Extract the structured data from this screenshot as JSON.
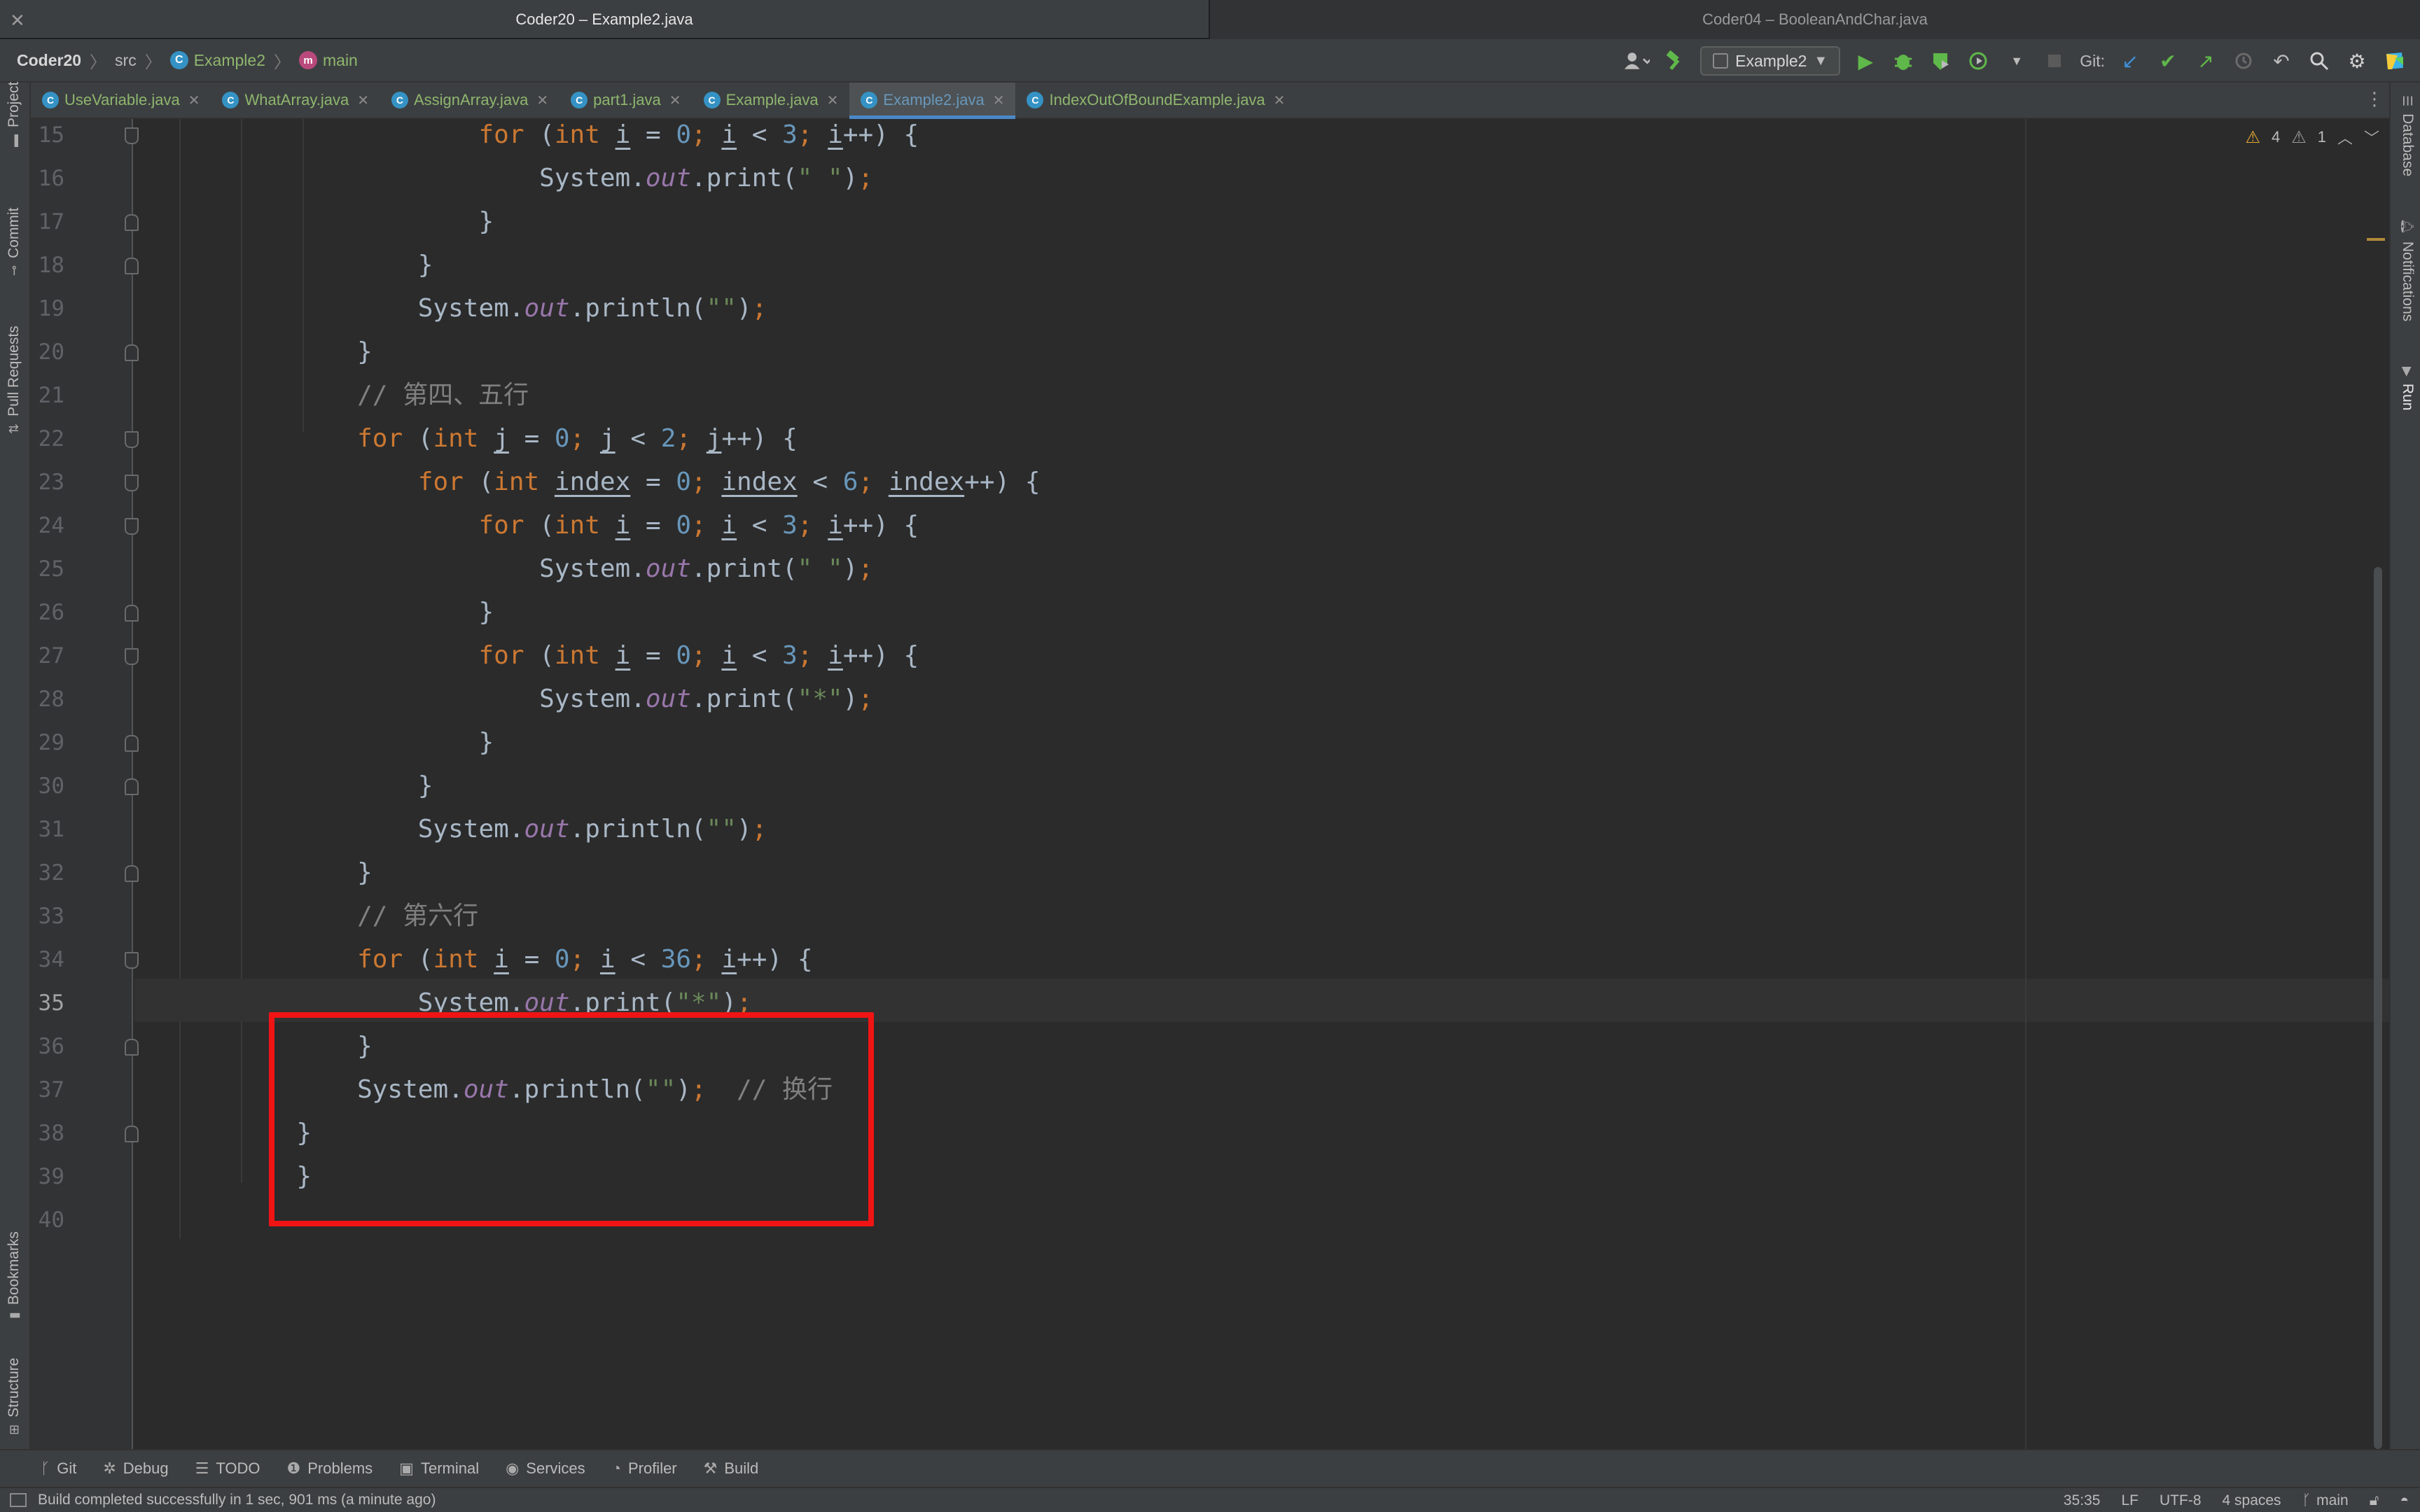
{
  "window_tabs": [
    "Coder20 – Example2.java",
    "Coder04 – BooleanAndChar.java"
  ],
  "breadcrumb": {
    "project": "Coder20",
    "folder": "src",
    "class": "Example2",
    "method": "main",
    "class_glyph": "C",
    "method_glyph": "m"
  },
  "toolbar": {
    "run_config": "Example2",
    "git_label": "Git:",
    "icons": [
      "account-icon",
      "build-hammer-icon",
      "run-icon",
      "debug-icon",
      "coverage-icon",
      "profile-icon",
      "stop-icon",
      "git-update-icon",
      "git-commit-icon",
      "git-push-icon",
      "history-icon",
      "rollback-icon",
      "search-icon",
      "settings-icon",
      "product-logo-icon"
    ]
  },
  "editor_tabs": [
    {
      "label": "UseVariable.java",
      "active": false
    },
    {
      "label": "WhatArray.java",
      "active": false
    },
    {
      "label": "AssignArray.java",
      "active": false
    },
    {
      "label": "part1.java",
      "active": false
    },
    {
      "label": "Example.java",
      "active": false
    },
    {
      "label": "Example2.java",
      "active": true
    },
    {
      "label": "IndexOutOfBoundExample.java",
      "active": false
    }
  ],
  "left_stripe": {
    "top": [
      "Project",
      "Commit",
      "Pull Requests"
    ],
    "bottom": [
      "Bookmarks",
      "Structure"
    ]
  },
  "right_stripe": [
    "Database",
    "Notifications",
    "Run"
  ],
  "inspections": {
    "warnings": "4",
    "weak_warnings": "1"
  },
  "editor": {
    "current_line": 35,
    "lines": [
      {
        "n": "15",
        "html": "            <span class=\"k\">for</span> (<span class=\"k\">int</span> <span class=\"u\">i</span> = <span class=\"n\">0</span><span class=\"k\">;</span> <span class=\"u\">i</span> &lt; <span class=\"n\">3</span><span class=\"k\">;</span> <span class=\"u\">i</span>++) {"
      },
      {
        "n": "16",
        "html": "                System.<span class=\"f\">out</span>.print(<span class=\"s\">\" \"</span>)<span class=\"k\">;</span>"
      },
      {
        "n": "17",
        "html": "            }"
      },
      {
        "n": "18",
        "html": "        }"
      },
      {
        "n": "19",
        "html": "        System.<span class=\"f\">out</span>.println(<span class=\"s\">\"\"</span>)<span class=\"k\">;</span>"
      },
      {
        "n": "20",
        "html": "    }"
      },
      {
        "n": "21",
        "html": "    <span class=\"c\">// 第四、五行</span>"
      },
      {
        "n": "22",
        "html": "    <span class=\"k\">for</span> (<span class=\"k\">int</span> <span class=\"u\">j</span> = <span class=\"n\">0</span><span class=\"k\">;</span> <span class=\"u\">j</span> &lt; <span class=\"n\">2</span><span class=\"k\">;</span> <span class=\"u\">j</span>++) {"
      },
      {
        "n": "23",
        "html": "        <span class=\"k\">for</span> (<span class=\"k\">int</span> <span class=\"u\">index</span> = <span class=\"n\">0</span><span class=\"k\">;</span> <span class=\"u\">index</span> &lt; <span class=\"n\">6</span><span class=\"k\">;</span> <span class=\"u\">index</span>++) {"
      },
      {
        "n": "24",
        "html": "            <span class=\"k\">for</span> (<span class=\"k\">int</span> <span class=\"u\">i</span> = <span class=\"n\">0</span><span class=\"k\">;</span> <span class=\"u\">i</span> &lt; <span class=\"n\">3</span><span class=\"k\">;</span> <span class=\"u\">i</span>++) {"
      },
      {
        "n": "25",
        "html": "                System.<span class=\"f\">out</span>.print(<span class=\"s\">\" \"</span>)<span class=\"k\">;</span>"
      },
      {
        "n": "26",
        "html": "            }"
      },
      {
        "n": "27",
        "html": "            <span class=\"k\">for</span> (<span class=\"k\">int</span> <span class=\"u\">i</span> = <span class=\"n\">0</span><span class=\"k\">;</span> <span class=\"u\">i</span> &lt; <span class=\"n\">3</span><span class=\"k\">;</span> <span class=\"u\">i</span>++) {"
      },
      {
        "n": "28",
        "html": "                System.<span class=\"f\">out</span>.print(<span class=\"s\">\"*\"</span>)<span class=\"k\">;</span>"
      },
      {
        "n": "29",
        "html": "            }"
      },
      {
        "n": "30",
        "html": "        }"
      },
      {
        "n": "31",
        "html": "        System.<span class=\"f\">out</span>.println(<span class=\"s\">\"\"</span>)<span class=\"k\">;</span>"
      },
      {
        "n": "32",
        "html": "    }"
      },
      {
        "n": "33",
        "html": "    <span class=\"c\">// 第六行</span>"
      },
      {
        "n": "34",
        "html": "    <span class=\"k\">for</span> (<span class=\"k\">int</span> <span class=\"u\">i</span> = <span class=\"n\">0</span><span class=\"k\">;</span> <span class=\"u\">i</span> &lt; <span class=\"n\">36</span><span class=\"k\">;</span> <span class=\"u\">i</span>++) {"
      },
      {
        "n": "35",
        "html": "        System.<span class=\"f\">out</span>.print(<span class=\"s\">\"*\"</span>)<span class=\"k\">;</span>"
      },
      {
        "n": "36",
        "html": "    }"
      },
      {
        "n": "37",
        "html": "    System.<span class=\"f\">out</span>.println(<span class=\"s\">\"\"</span>)<span class=\"k\">;</span>  <span class=\"c\">// 换行</span>"
      },
      {
        "n": "38",
        "html": "}"
      },
      {
        "n": "39",
        "html": "}"
      },
      {
        "n": "40",
        "html": ""
      }
    ]
  },
  "tool_windows": [
    "Git",
    "Debug",
    "TODO",
    "Problems",
    "Terminal",
    "Services",
    "Profiler",
    "Build"
  ],
  "status": {
    "message": "Build completed successfully in 1 sec, 901 ms (a minute ago)",
    "position": "35:35",
    "line_separator": "LF",
    "encoding": "UTF-8",
    "indent": "4 spaces",
    "branch": "main"
  },
  "colors": {
    "highlight_box": "#f01414",
    "keyword": "#cc7832",
    "number": "#6897bb",
    "string": "#6a8759",
    "comment": "#808080",
    "field": "#9876aa"
  }
}
